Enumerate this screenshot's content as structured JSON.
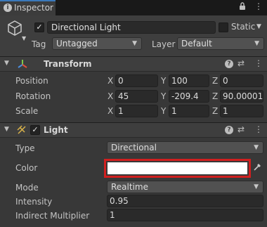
{
  "tab": {
    "title": "Inspector"
  },
  "object": {
    "name": "Directional Light",
    "static_label": "Static",
    "tag_label": "Tag",
    "tag_value": "Untagged",
    "layer_label": "Layer",
    "layer_value": "Default"
  },
  "transform": {
    "title": "Transform",
    "rows": [
      {
        "label": "Position",
        "x": "0",
        "y": "100",
        "z": "0"
      },
      {
        "label": "Rotation",
        "x": "45",
        "y": "-209.4",
        "z": "90.00001"
      },
      {
        "label": "Scale",
        "x": "1",
        "y": "1",
        "z": "1"
      }
    ],
    "axis_x": "X",
    "axis_y": "Y",
    "axis_z": "Z"
  },
  "light": {
    "title": "Light",
    "type_label": "Type",
    "type_value": "Directional",
    "color_label": "Color",
    "color_value": "#ffffff",
    "highlight_color": "#d11f1f",
    "mode_label": "Mode",
    "mode_value": "Realtime",
    "intensity_label": "Intensity",
    "intensity_value": "0.95",
    "indirect_label": "Indirect Multiplier",
    "indirect_value": "1"
  },
  "icons": {
    "lock": "lock-icon",
    "menu": "kebab-menu-icon",
    "help": "help-icon",
    "presets": "presets-icon"
  }
}
